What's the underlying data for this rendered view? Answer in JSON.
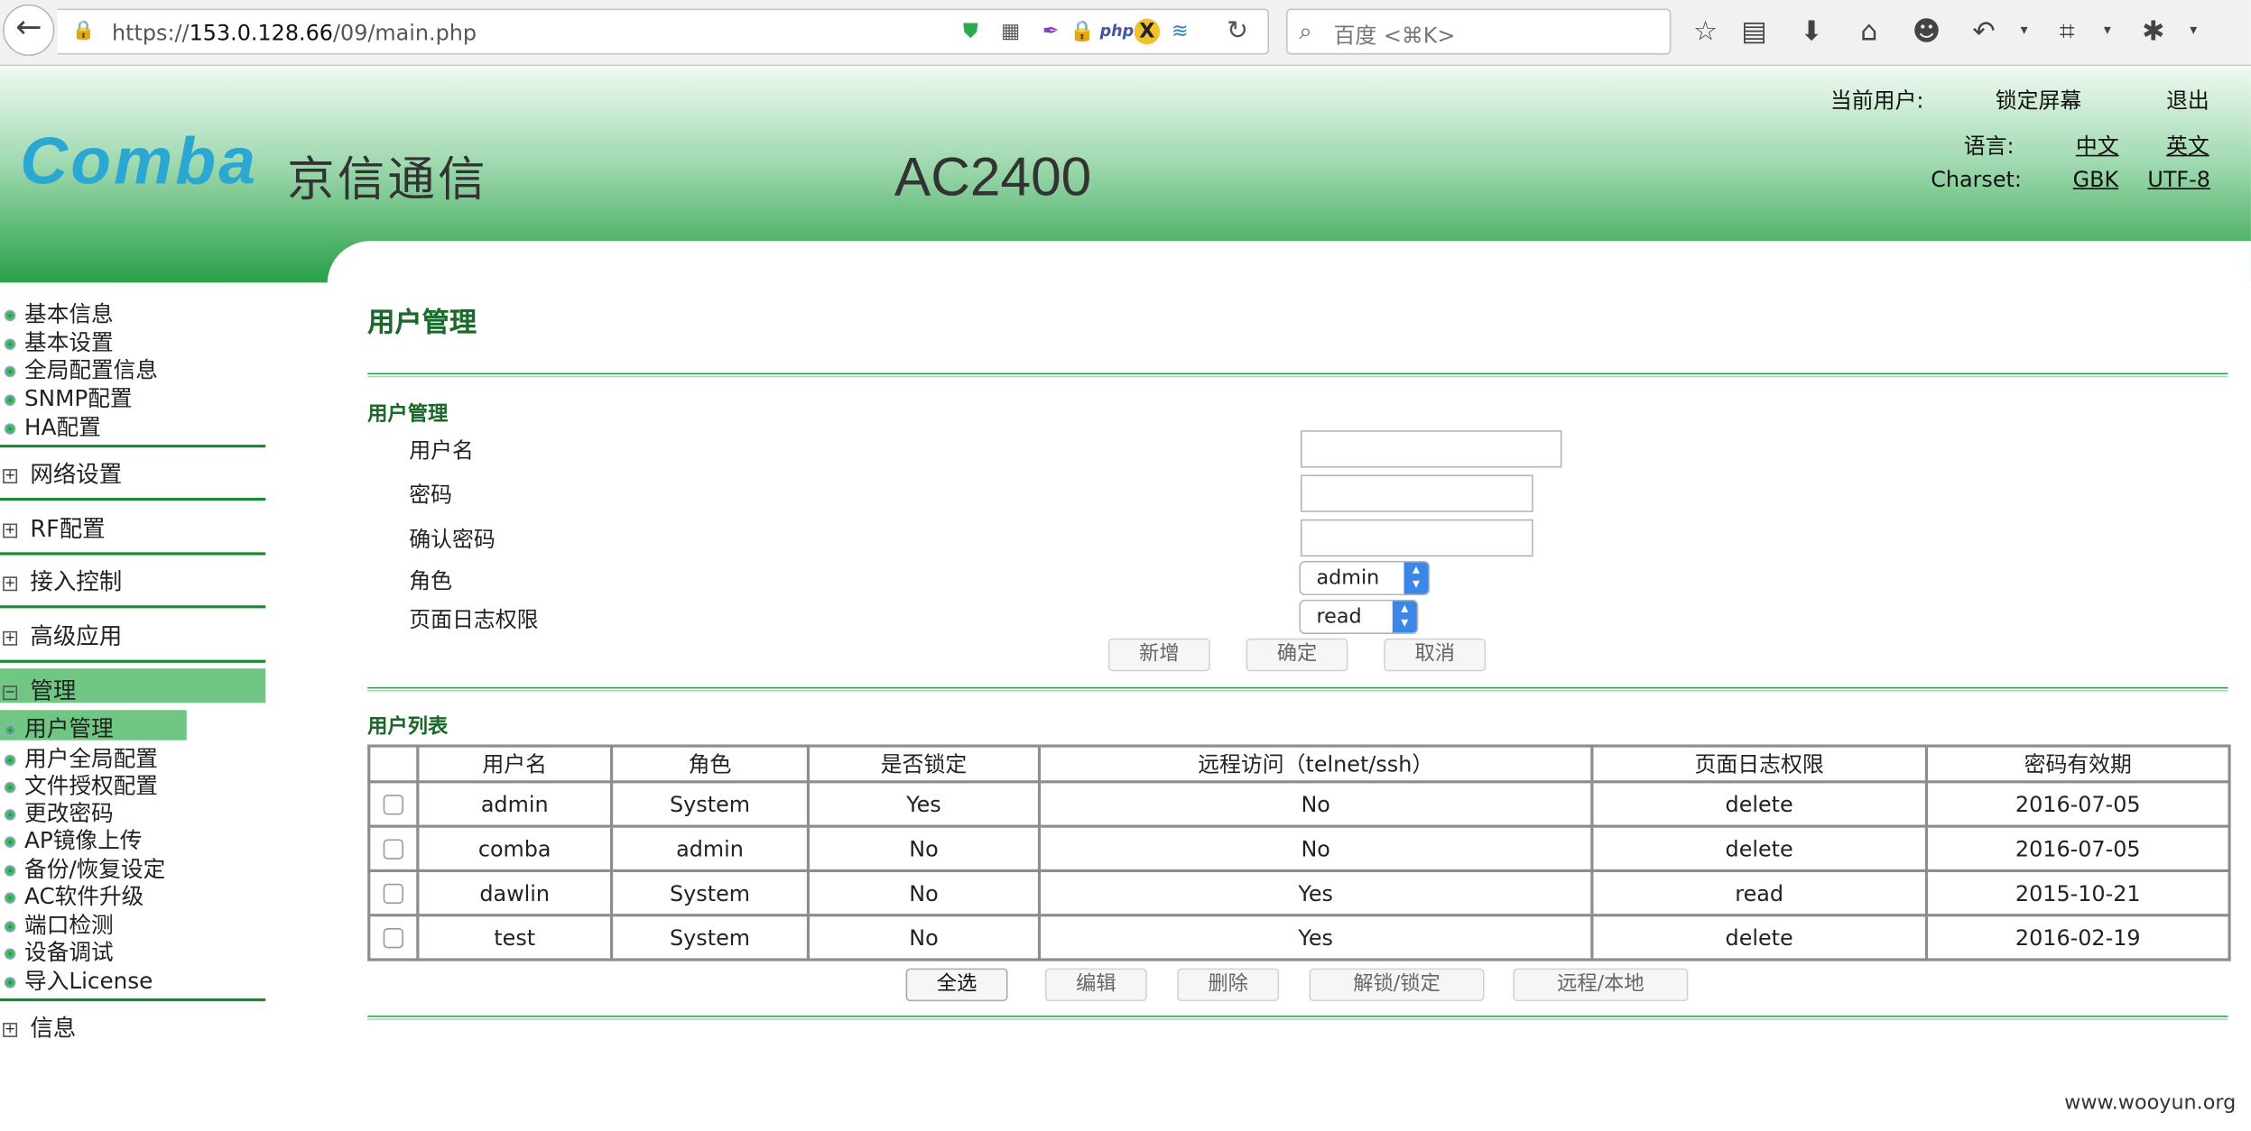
{
  "browser": {
    "url_prefix": "https://",
    "url_host": "153.0.128.66",
    "url_path": "/09/main.php",
    "search_placeholder": "百度 <⌘K>"
  },
  "header": {
    "logo_text": "Comba",
    "logo_cn": "京信通信",
    "product": "AC2400",
    "current_user_label": "当前用户:",
    "lock_screen": "锁定屏幕",
    "logout": "退出",
    "language_label": "语言:",
    "lang_cn": "中文",
    "lang_en": "英文",
    "charset_label": "Charset:",
    "charset_gbk": "GBK",
    "charset_utf8": "UTF-8"
  },
  "sidebar": {
    "top_items": [
      "基本信息",
      "基本设置",
      "全局配置信息",
      "SNMP配置",
      "HA配置"
    ],
    "categories": [
      "网络设置",
      "RF配置",
      "接入控制",
      "高级应用"
    ],
    "manage_label": "管理",
    "manage_items": [
      "用户管理",
      "用户全局配置",
      "文件授权配置",
      "更改密码",
      "AP镜像上传",
      "备份/恢复设定",
      "AC软件升级",
      "端口检测",
      "设备调试",
      "导入License"
    ],
    "info_label": "信息"
  },
  "main": {
    "page_title": "用户管理",
    "form_section_title": "用户管理",
    "form": {
      "username_label": "用户名",
      "password_label": "密码",
      "confirm_label": "确认密码",
      "role_label": "角色",
      "role_value": "admin",
      "log_perm_label": "页面日志权限",
      "log_perm_value": "read"
    },
    "form_buttons": {
      "add": "新增",
      "confirm": "确定",
      "cancel": "取消"
    },
    "list_title": "用户列表",
    "table": {
      "headers": [
        "用户名",
        "角色",
        "是否锁定",
        "远程访问（telnet/ssh）",
        "页面日志权限",
        "密码有效期"
      ],
      "rows": [
        [
          "admin",
          "System",
          "Yes",
          "No",
          "delete",
          "2016-07-05"
        ],
        [
          "comba",
          "admin",
          "No",
          "No",
          "delete",
          "2016-07-05"
        ],
        [
          "dawlin",
          "System",
          "No",
          "Yes",
          "read",
          "2015-10-21"
        ],
        [
          "test",
          "System",
          "No",
          "Yes",
          "delete",
          "2016-02-19"
        ]
      ]
    },
    "table_buttons": {
      "select_all": "全选",
      "edit": "编辑",
      "delete": "删除",
      "unlock_lock": "解锁/锁定",
      "remote_local": "远程/本地"
    }
  },
  "watermark": "www.wooyun.org",
  "colors": {
    "header_green": "#28a048",
    "title_green": "#1b6a2c",
    "active_bg": "#6fc783",
    "logo_blue": "#2aa7d2"
  }
}
